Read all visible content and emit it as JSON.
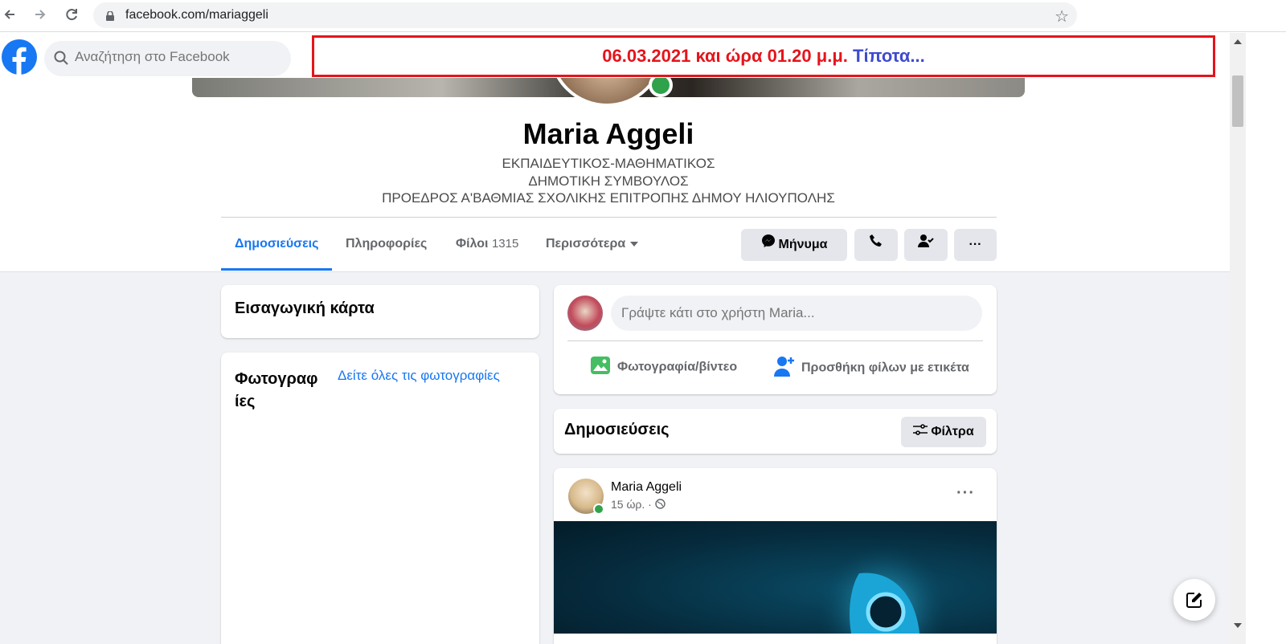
{
  "browser": {
    "url": "facebook.com/mariaggeli"
  },
  "topbar": {
    "search_placeholder": "Αναζήτηση στο Facebook"
  },
  "banner": {
    "date_text": "06.03.2021 και ώρα 01.20 μ.μ.",
    "note_text": "Τίποτα...",
    "date_color": "#e5141b",
    "note_color": "#3f4bd0"
  },
  "profile": {
    "name": "Maria Aggeli",
    "bio_lines": [
      "ΕΚΠΑΙΔΕΥΤΙΚΟΣ-ΜΑΘΗΜΑΤΙΚΟΣ",
      "ΔΗΜΟΤΙΚΗ ΣΥΜΒΟΥΛΟΣ",
      "ΠΡΟΕΔΡΟΣ Α'ΒΑΘΜΙΑΣ ΣΧΟΛΙΚΗΣ ΕΠΙΤΡΟΠΗΣ ΔΗΜΟΥ ΗΛΙΟΥΠΟΛΗΣ"
    ]
  },
  "tabs": {
    "posts": "Δημοσιεύσεις",
    "about": "Πληροφορίες",
    "friends": "Φίλοι",
    "friends_count": "1315",
    "more": "Περισσότερα"
  },
  "actions": {
    "message": "Μήνυμα"
  },
  "intro_card": {
    "title": "Εισαγωγική κάρτα"
  },
  "photos_card": {
    "title_line1": "Φωτογραφ",
    "title_line2": "ίες",
    "see_all": "Δείτε όλες τις φωτογραφίες"
  },
  "composer": {
    "placeholder": "Γράψτε κάτι στο χρήστη Maria...",
    "photo_video": "Φωτογραφία/βίντεο",
    "tag_friends": "Προσθήκη φίλων με ετικέτα"
  },
  "posts_header": {
    "title": "Δημοσιεύσεις",
    "filters": "Φίλτρα"
  },
  "post": {
    "author": "Maria Aggeli",
    "time": "15 ώρ. ·"
  },
  "colors": {
    "fb_blue": "#1877f2",
    "online_green": "#31a24c"
  }
}
